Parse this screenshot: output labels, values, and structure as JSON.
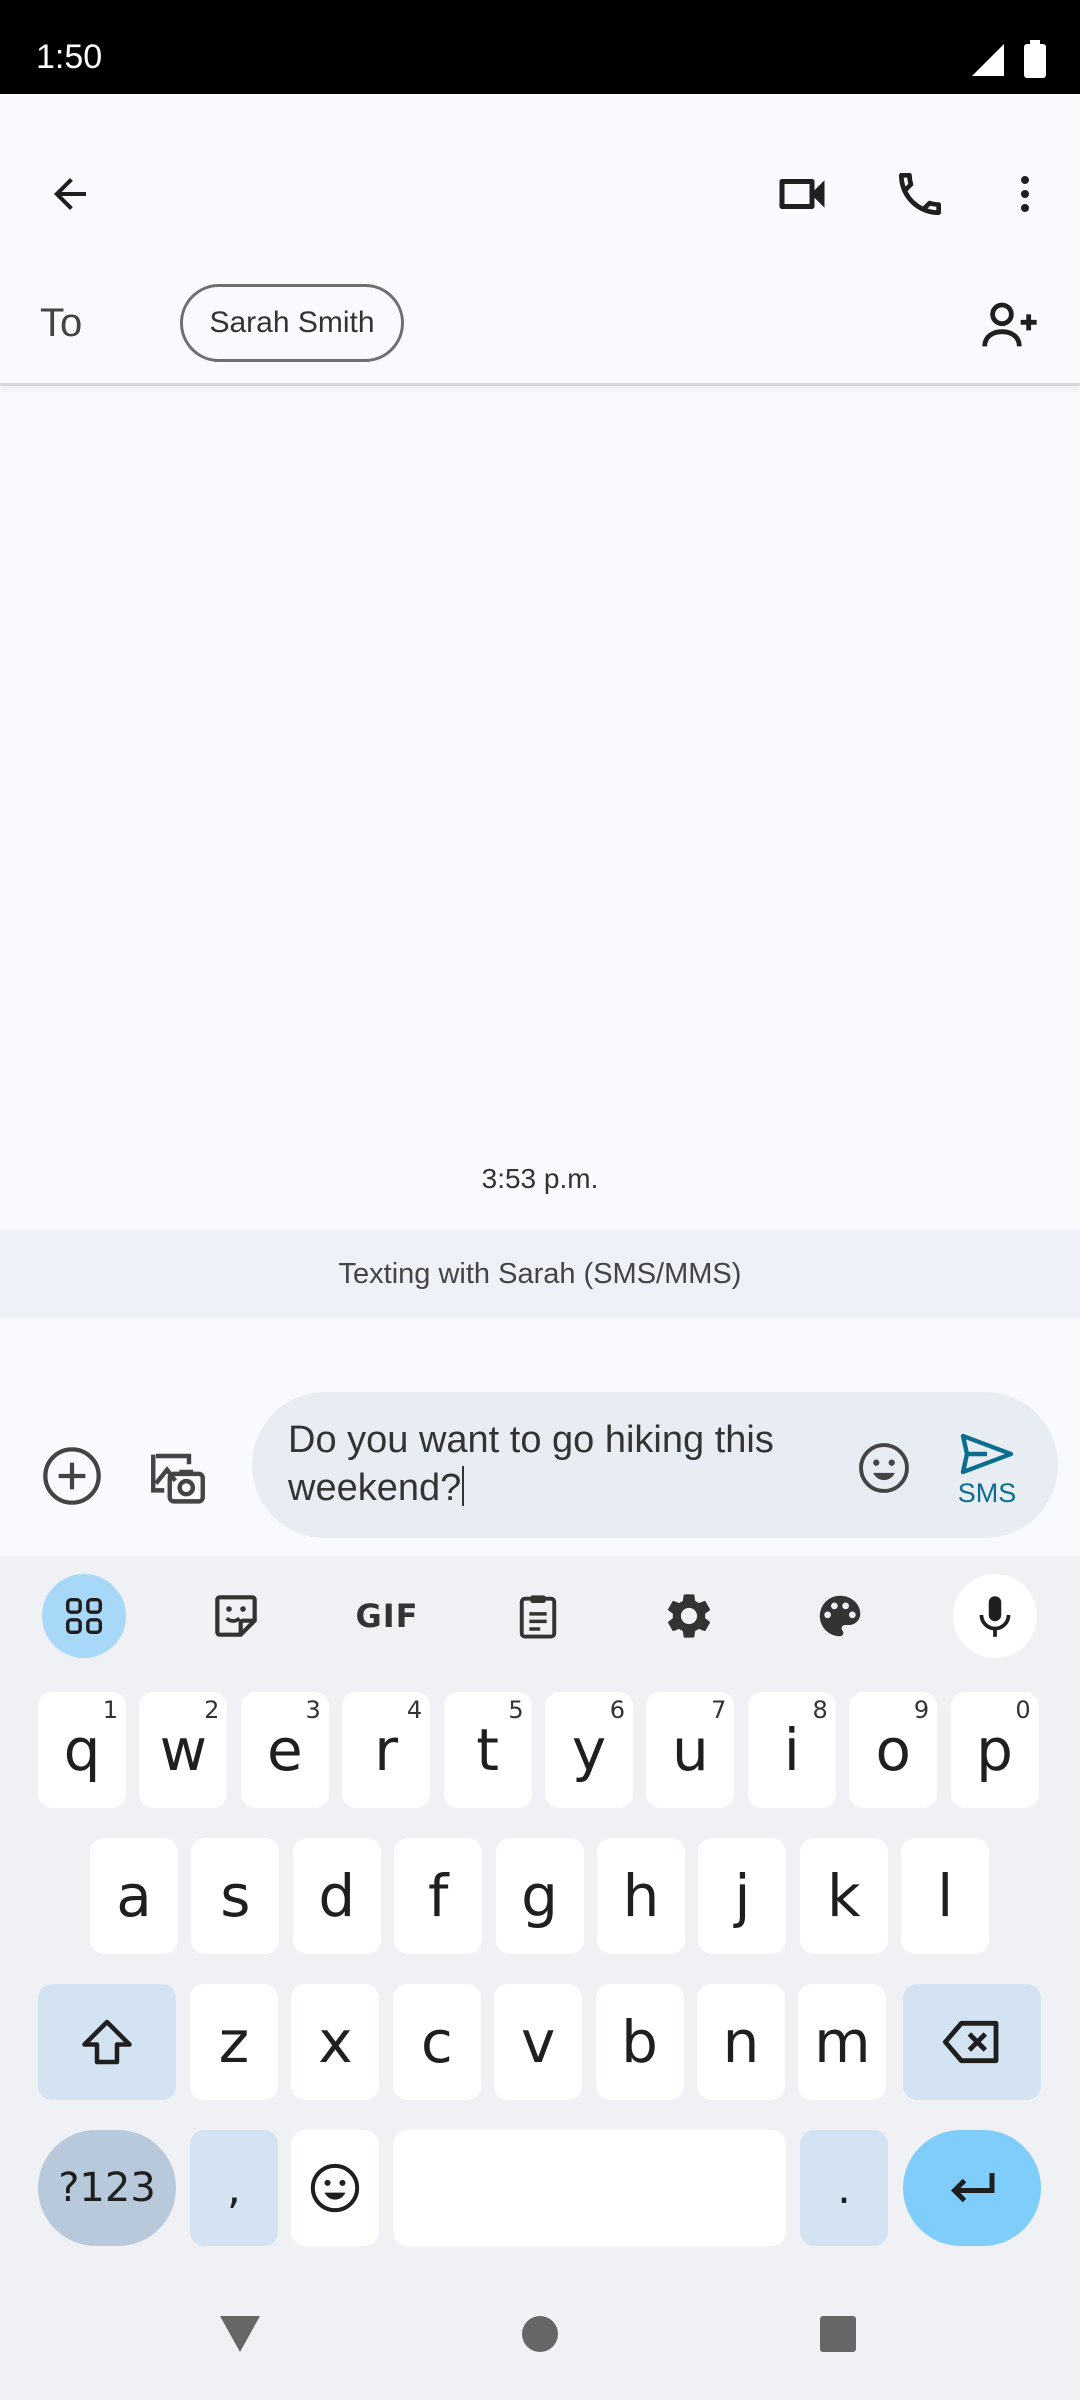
{
  "status_bar": {
    "time": "1:50"
  },
  "header": {
    "to_label": "To",
    "recipient_chip": "Sarah Smith"
  },
  "conversation": {
    "timestamp": "3:53 p.m.",
    "texting_banner": "Texting with Sarah (SMS/MMS)"
  },
  "compose": {
    "text": "Do you want to go hiking this weekend?",
    "send_label": "SMS"
  },
  "keyboard": {
    "toolbar": [
      "apps-grid-icon",
      "sticker-icon",
      "gif-icon",
      "clipboard-icon",
      "gear-icon",
      "palette-icon",
      "mic-icon"
    ],
    "row1": [
      {
        "k": "q",
        "h": "1"
      },
      {
        "k": "w",
        "h": "2"
      },
      {
        "k": "e",
        "h": "3"
      },
      {
        "k": "r",
        "h": "4"
      },
      {
        "k": "t",
        "h": "5"
      },
      {
        "k": "y",
        "h": "6"
      },
      {
        "k": "u",
        "h": "7"
      },
      {
        "k": "i",
        "h": "8"
      },
      {
        "k": "o",
        "h": "9"
      },
      {
        "k": "p",
        "h": "0"
      }
    ],
    "row2": [
      "a",
      "s",
      "d",
      "f",
      "g",
      "h",
      "j",
      "k",
      "l"
    ],
    "row3": [
      "z",
      "x",
      "c",
      "v",
      "b",
      "n",
      "m"
    ],
    "sym_label": "?123",
    "comma": ",",
    "period": ".",
    "gif_label": "GIF"
  },
  "colors": {
    "accent": "#0b6e8f",
    "active_tool": "#a8d8f7",
    "enter": "#7fcdfa",
    "mod_key": "#d3e3f2"
  }
}
